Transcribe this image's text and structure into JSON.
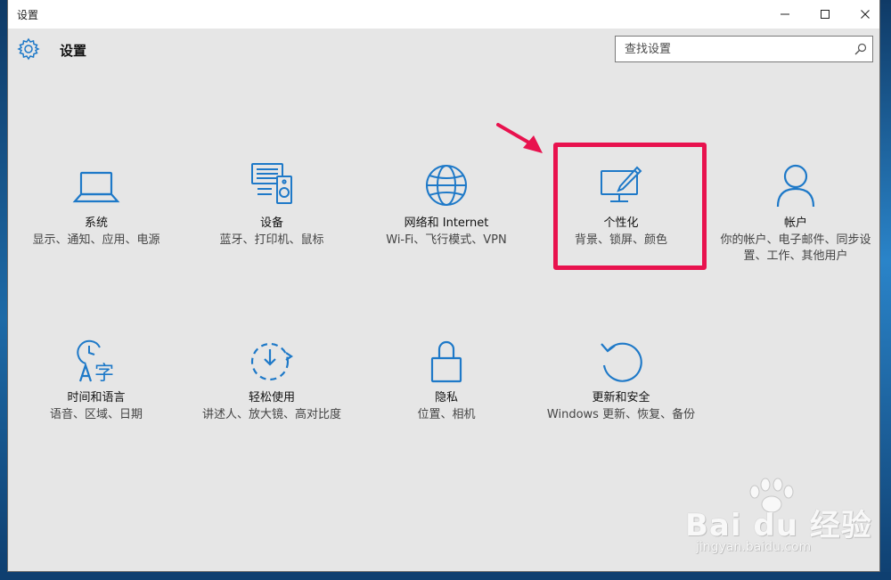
{
  "window": {
    "title": "设置",
    "minimize_icon": "minimize-icon",
    "maximize_icon": "maximize-icon",
    "close_icon": "close-icon"
  },
  "header": {
    "title": "设置",
    "search_placeholder": "查找设置"
  },
  "tiles": [
    {
      "icon": "laptop-icon",
      "title": "系统",
      "desc": "显示、通知、应用、电源"
    },
    {
      "icon": "devices-icon",
      "title": "设备",
      "desc": "蓝牙、打印机、鼠标"
    },
    {
      "icon": "globe-icon",
      "title": "网络和 Internet",
      "desc": "Wi-Fi、飞行模式、VPN"
    },
    {
      "icon": "personalization-icon",
      "title": "个性化",
      "desc": "背景、锁屏、颜色"
    },
    {
      "icon": "person-icon",
      "title": "帐户",
      "desc": "你的帐户、电子邮件、同步设置、工作、其他用户"
    },
    {
      "icon": "time-language-icon",
      "title": "时间和语言",
      "desc": "语音、区域、日期"
    },
    {
      "icon": "ease-of-access-icon",
      "title": "轻松使用",
      "desc": "讲述人、放大镜、高对比度"
    },
    {
      "icon": "lock-icon",
      "title": "隐私",
      "desc": "位置、相机"
    },
    {
      "icon": "refresh-icon",
      "title": "更新和安全",
      "desc": "Windows 更新、恢复、备份"
    }
  ],
  "annotation": {
    "highlight_color": "#e8124e"
  },
  "watermark": {
    "brand": "Bai du 经验",
    "url": "jingyan.baidu.com"
  },
  "colors": {
    "accent": "#1e79c8",
    "window_bg": "#e6e6e6"
  }
}
